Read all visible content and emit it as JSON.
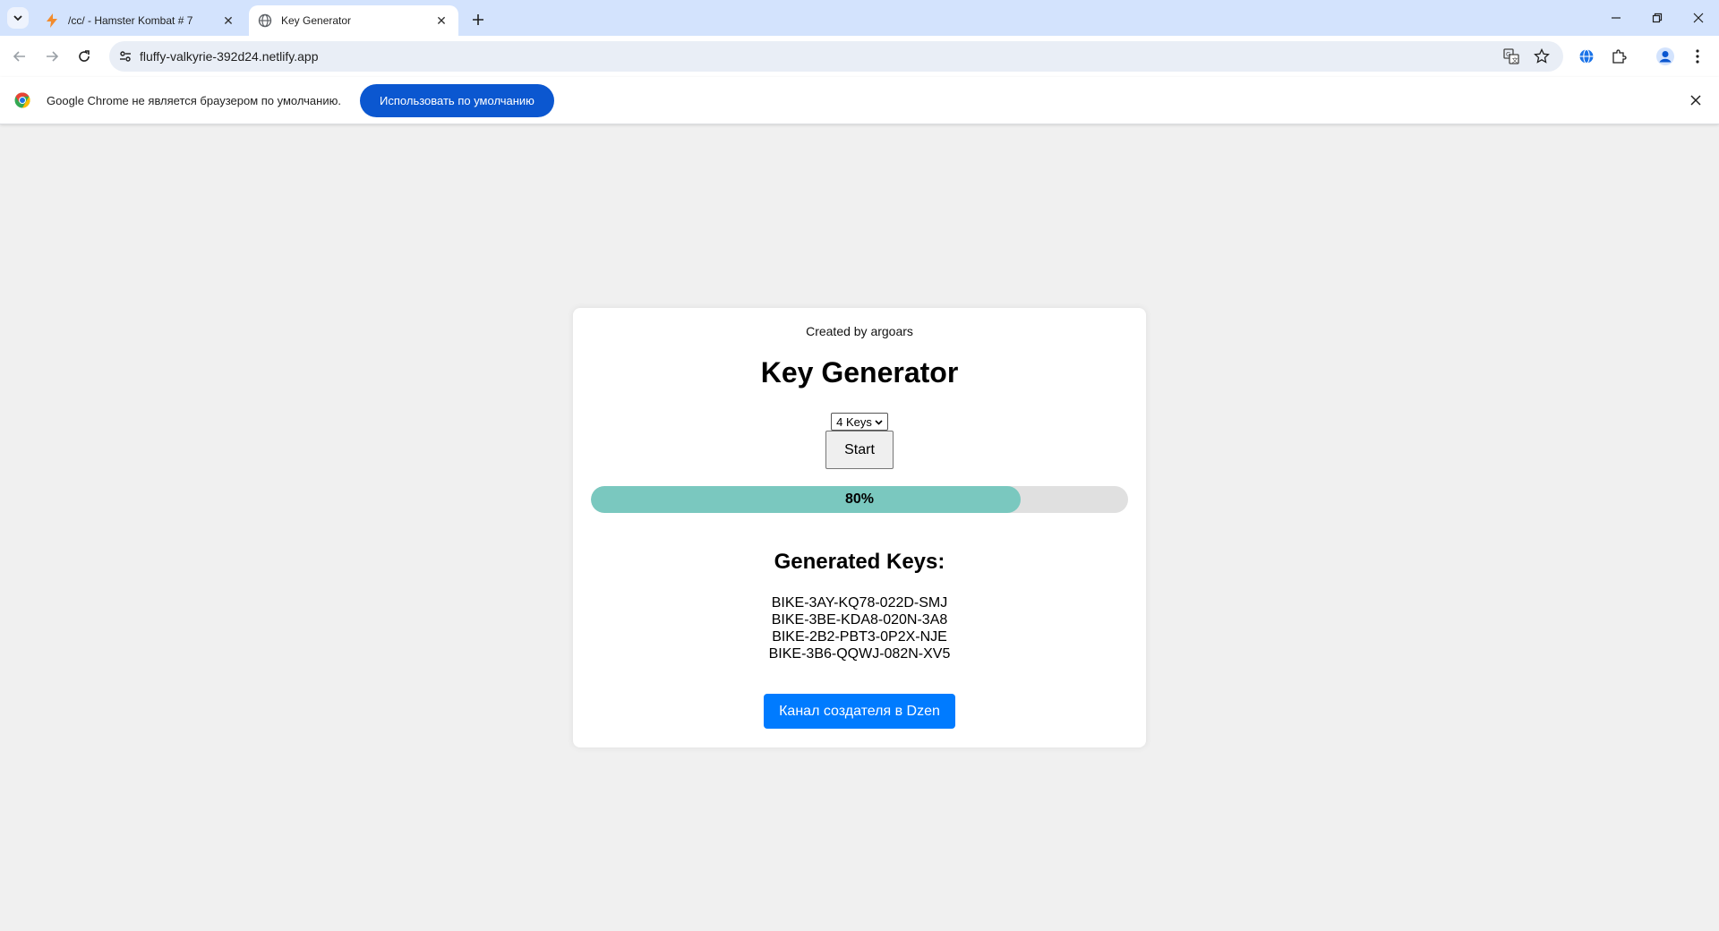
{
  "browser": {
    "tabs": [
      {
        "title": "/cc/ - Hamster Kombat # 7",
        "active": false,
        "icon": "bolt-icon"
      },
      {
        "title": "Key Generator",
        "active": true,
        "icon": "globe-icon"
      }
    ],
    "address_bar": {
      "url": "fluffy-valkyrie-392d24.netlify.app"
    },
    "infobar": {
      "message": "Google Chrome не является браузером по умолчанию.",
      "button_label": "Использовать по умолчанию"
    }
  },
  "page": {
    "creator_text": "Created by argoars",
    "title": "Key Generator",
    "key_count_select": {
      "selected": "4 Keys"
    },
    "start_label": "Start",
    "progress": {
      "percent": 80,
      "label": "80%"
    },
    "keys_heading": "Generated Keys:",
    "keys": [
      "BIKE-3AY-KQ78-022D-SMJ",
      "BIKE-3BE-KDA8-020N-3A8",
      "BIKE-2B2-PBT3-0P2X-NJE",
      "BIKE-3B6-QQWJ-082N-XV5"
    ],
    "dzen_button_label": "Канал создателя в Dzen"
  },
  "colors": {
    "tabstrip_bg": "#d3e3fd",
    "accent_blue": "#0b57d0",
    "progress_fill": "#7ac8bf",
    "dzen_button": "#007bff",
    "page_bg": "#f0f0f0"
  }
}
